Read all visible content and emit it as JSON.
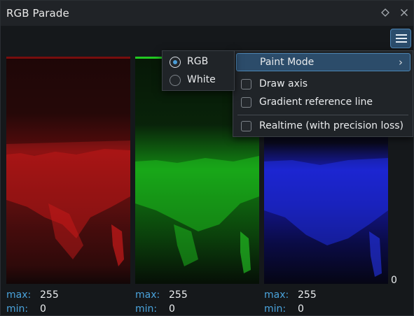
{
  "window": {
    "title": "RGB Parade",
    "float_icon": "diamond-icon",
    "close_icon": "close-icon"
  },
  "toolbar": {
    "menu_icon": "hamburger-menu-icon"
  },
  "axis": {
    "zero_label": "0"
  },
  "channels": [
    {
      "name": "red",
      "color": "#e01818",
      "max_label": "max:",
      "max_value": "255",
      "min_label": "min:",
      "min_value": "0"
    },
    {
      "name": "green",
      "color": "#1fd21f",
      "max_label": "max:",
      "max_value": "255",
      "min_label": "min:",
      "min_value": "0"
    },
    {
      "name": "blue",
      "color": "#1f2ef0",
      "max_label": "max:",
      "max_value": "255",
      "min_label": "min:",
      "min_value": "0"
    }
  ],
  "context_menu": {
    "items": [
      {
        "label": "Paint Mode",
        "has_submenu": true,
        "arrow": "›"
      },
      {
        "label": "Draw axis",
        "checked": false
      },
      {
        "label": "Gradient reference line",
        "checked": false
      },
      {
        "label": "Realtime (with precision loss)",
        "checked": false
      }
    ]
  },
  "paint_mode_submenu": {
    "options": [
      {
        "label": "RGB",
        "selected": true
      },
      {
        "label": "White",
        "selected": false
      }
    ]
  },
  "colors": {
    "accent": "#4aa3dc",
    "selection": "#2c4c6a",
    "background": "#15181b"
  }
}
